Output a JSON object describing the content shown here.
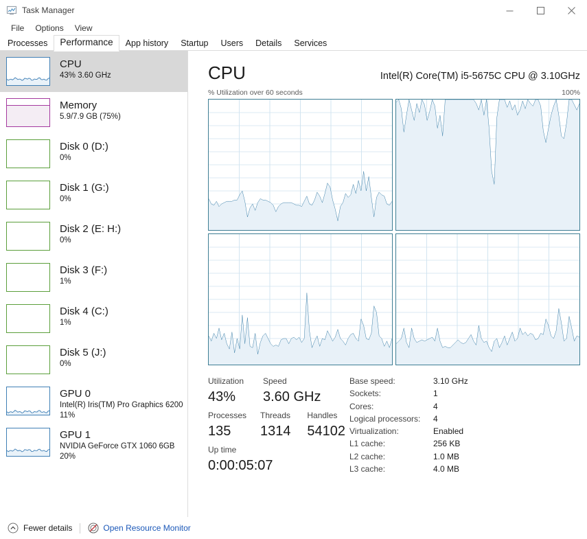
{
  "window": {
    "title": "Task Manager",
    "icon": "task-manager-icon",
    "controls": {
      "minimize": "minimize-icon",
      "maximize": "maximize-icon",
      "close": "close-icon"
    }
  },
  "menu": {
    "items": [
      "File",
      "Options",
      "View"
    ]
  },
  "tabs": {
    "items": [
      "Processes",
      "Performance",
      "App history",
      "Startup",
      "Users",
      "Details",
      "Services"
    ],
    "active": "Performance"
  },
  "sidebar": {
    "items": [
      {
        "title": "CPU",
        "sub": "43% 3.60 GHz",
        "sub2": "",
        "color": "#3f7fb5",
        "selected": true,
        "fill": 22,
        "style": "line"
      },
      {
        "title": "Memory",
        "sub": "5.9/7.9 GB (75%)",
        "sub2": "",
        "color": "#a4389e",
        "selected": false,
        "fill": 75,
        "style": "area"
      },
      {
        "title": "Disk 0 (D:)",
        "sub": "0%",
        "sub2": "",
        "color": "#5a9e3a",
        "selected": false,
        "fill": 0,
        "style": "flat"
      },
      {
        "title": "Disk 1 (G:)",
        "sub": "0%",
        "sub2": "",
        "color": "#5a9e3a",
        "selected": false,
        "fill": 0,
        "style": "flat"
      },
      {
        "title": "Disk 2 (E: H:)",
        "sub": "0%",
        "sub2": "",
        "color": "#5a9e3a",
        "selected": false,
        "fill": 0,
        "style": "flat"
      },
      {
        "title": "Disk 3 (F:)",
        "sub": "1%",
        "sub2": "",
        "color": "#5a9e3a",
        "selected": false,
        "fill": 0,
        "style": "flat"
      },
      {
        "title": "Disk 4 (C:)",
        "sub": "1%",
        "sub2": "",
        "color": "#5a9e3a",
        "selected": false,
        "fill": 0,
        "style": "flat"
      },
      {
        "title": "Disk 5 (J:)",
        "sub": "0%",
        "sub2": "",
        "color": "#5a9e3a",
        "selected": false,
        "fill": 0,
        "style": "flat"
      },
      {
        "title": "GPU 0",
        "sub": "Intel(R) Iris(TM) Pro Graphics 6200",
        "sub2": "11%",
        "color": "#3f7fb5",
        "selected": false,
        "fill": 11,
        "style": "line"
      },
      {
        "title": "GPU 1",
        "sub": "NVIDIA GeForce GTX 1060 6GB",
        "sub2": "20%",
        "color": "#3f7fb5",
        "selected": false,
        "fill": 20,
        "style": "line"
      }
    ]
  },
  "main": {
    "title": "CPU",
    "model": "Intel(R) Core(TM) i5-5675C CPU @ 3.10GHz",
    "graph_label_left": "% Utilization over 60 seconds",
    "graph_label_right": "100%",
    "stats": {
      "utilization_label": "Utilization",
      "utilization_value": "43%",
      "speed_label": "Speed",
      "speed_value": "3.60 GHz",
      "processes_label": "Processes",
      "processes_value": "135",
      "threads_label": "Threads",
      "threads_value": "1314",
      "handles_label": "Handles",
      "handles_value": "54102",
      "uptime_label": "Up time",
      "uptime_value": "0:00:05:07"
    },
    "specs": [
      {
        "label": "Base speed:",
        "value": "3.10 GHz"
      },
      {
        "label": "Sockets:",
        "value": "1"
      },
      {
        "label": "Cores:",
        "value": "4"
      },
      {
        "label": "Logical processors:",
        "value": "4"
      },
      {
        "label": "Virtualization:",
        "value": "Enabled"
      },
      {
        "label": "L1 cache:",
        "value": "256 KB"
      },
      {
        "label": "L2 cache:",
        "value": "1.0 MB"
      },
      {
        "label": "L3 cache:",
        "value": "4.0 MB"
      }
    ]
  },
  "chart_data": [
    {
      "type": "area",
      "title": "CPU 0 utilization",
      "ylabel": "% Utilization",
      "xlabel": "60 seconds",
      "ylim": [
        0,
        100
      ],
      "grid": true,
      "values": [
        24,
        20,
        19,
        22,
        18,
        20,
        21,
        22,
        22,
        22,
        23,
        23,
        27,
        30,
        22,
        10,
        17,
        20,
        15,
        21,
        24,
        23,
        23,
        22,
        21,
        19,
        14,
        18,
        20,
        21,
        21,
        21,
        21,
        20,
        19,
        19,
        18,
        22,
        26,
        20,
        19,
        23,
        29,
        26,
        21,
        28,
        36,
        33,
        23,
        16,
        7,
        18,
        21,
        28,
        25,
        27,
        35,
        28,
        38,
        30,
        45,
        30,
        41,
        25,
        10,
        25,
        29,
        27,
        26,
        20,
        19,
        22
      ]
    },
    {
      "type": "area",
      "title": "CPU 1 utilization",
      "ylabel": "% Utilization",
      "xlabel": "60 seconds",
      "ylim": [
        0,
        100
      ],
      "grid": true,
      "values": [
        98,
        100,
        93,
        75,
        88,
        100,
        92,
        84,
        97,
        90,
        100,
        96,
        84,
        91,
        100,
        95,
        78,
        88,
        72,
        100,
        100,
        100,
        100,
        100,
        100,
        100,
        100,
        100,
        100,
        100,
        100,
        97,
        92,
        100,
        88,
        100,
        78,
        45,
        35,
        86,
        100,
        100,
        100,
        94,
        99,
        92,
        96,
        88,
        92,
        99,
        93,
        100,
        97,
        95,
        100,
        100,
        95,
        76,
        67,
        78,
        88,
        95,
        100,
        88,
        72,
        70,
        82,
        100,
        100,
        96,
        92,
        97
      ]
    },
    {
      "type": "area",
      "title": "CPU 2 utilization",
      "ylabel": "% Utilization",
      "xlabel": "60 seconds",
      "ylim": [
        0,
        100
      ],
      "grid": true,
      "values": [
        22,
        18,
        24,
        20,
        28,
        19,
        24,
        16,
        12,
        25,
        9,
        20,
        12,
        38,
        16,
        36,
        14,
        13,
        24,
        8,
        17,
        22,
        24,
        20,
        16,
        14,
        15,
        14,
        19,
        20,
        20,
        16,
        20,
        21,
        19,
        21,
        17,
        20,
        55,
        26,
        13,
        18,
        22,
        14,
        20,
        19,
        26,
        22,
        18,
        21,
        27,
        20,
        18,
        15,
        20,
        23,
        24,
        20,
        18,
        35,
        30,
        20,
        19,
        24,
        45,
        40,
        22,
        20,
        14,
        18,
        13,
        20
      ]
    },
    {
      "type": "area",
      "title": "CPU 3 utilization",
      "ylabel": "% Utilization",
      "xlabel": "60 seconds",
      "ylim": [
        0,
        100
      ],
      "grid": true,
      "values": [
        16,
        18,
        20,
        28,
        17,
        13,
        28,
        20,
        17,
        18,
        19,
        18,
        19,
        20,
        21,
        18,
        28,
        18,
        13,
        14,
        13,
        13,
        15,
        17,
        19,
        17,
        16,
        17,
        20,
        23,
        18,
        15,
        30,
        20,
        17,
        18,
        13,
        10,
        18,
        20,
        13,
        17,
        22,
        15,
        20,
        25,
        18,
        20,
        28,
        23,
        25,
        22,
        24,
        23,
        19,
        20,
        24,
        23,
        35,
        30,
        22,
        20,
        26,
        43,
        32,
        18,
        20,
        37,
        28,
        18,
        22,
        21
      ]
    }
  ],
  "footer": {
    "fewer_details": "Fewer details",
    "fewer_details_icon": "chevron-up-circle-icon",
    "resource_monitor": "Open Resource Monitor",
    "resource_monitor_icon": "resource-monitor-icon"
  }
}
